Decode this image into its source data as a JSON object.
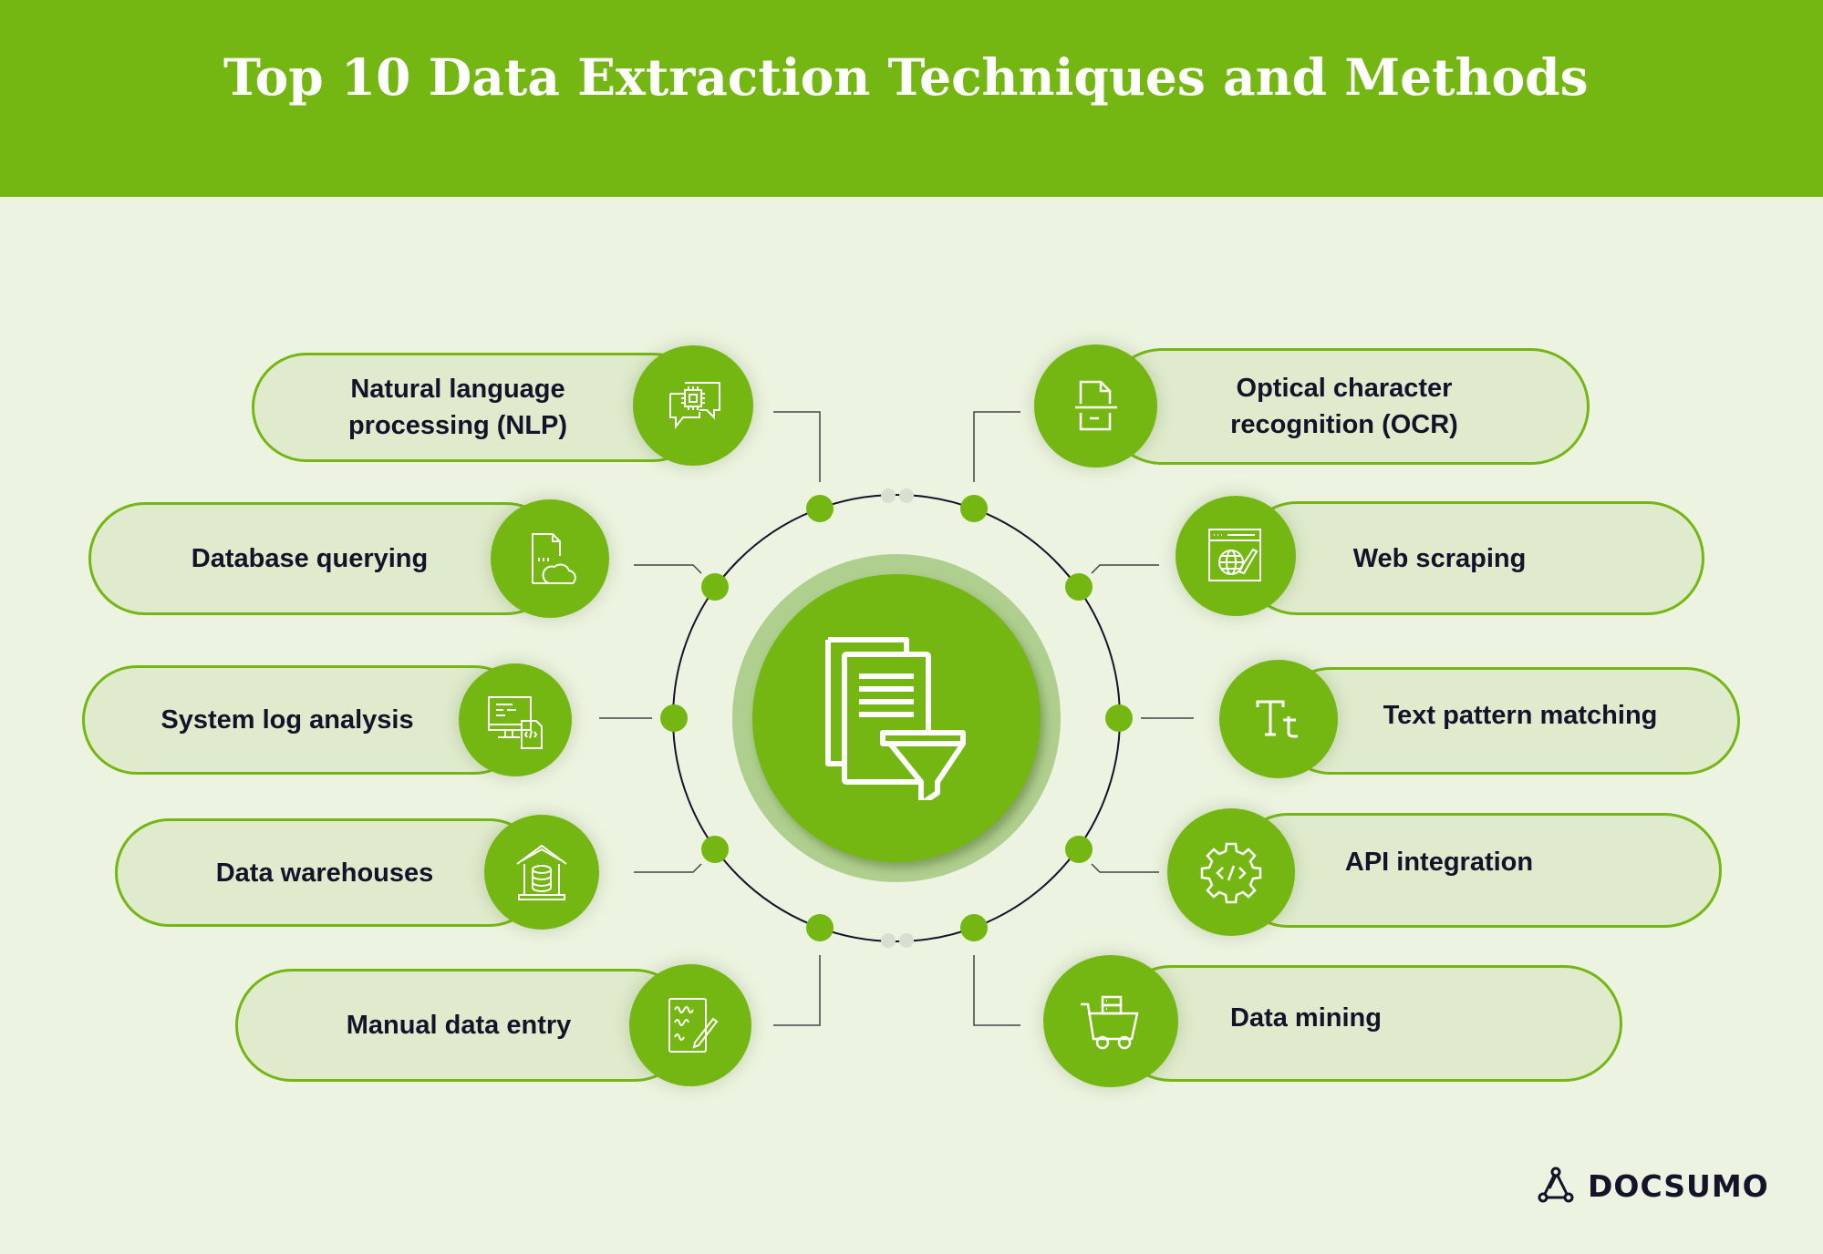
{
  "header": {
    "title": "Top 10 Data Extraction Techniques and Methods"
  },
  "center": {
    "icon": "documents-funnel-icon"
  },
  "techniques": {
    "left": [
      {
        "label_lines": [
          "Natural language",
          "processing (NLP)"
        ],
        "icon": "chat-chip-icon"
      },
      {
        "label_lines": [
          "Database querying"
        ],
        "icon": "database-cloud-icon"
      },
      {
        "label_lines": [
          "System log analysis"
        ],
        "icon": "monitor-code-file-icon"
      },
      {
        "label_lines": [
          "Data warehouses"
        ],
        "icon": "warehouse-database-icon"
      },
      {
        "label_lines": [
          "Manual data entry"
        ],
        "icon": "handwritten-form-icon"
      }
    ],
    "right": [
      {
        "label_lines": [
          "Optical character",
          "recognition (OCR)"
        ],
        "icon": "document-scan-icon"
      },
      {
        "label_lines": [
          "Web scraping"
        ],
        "icon": "browser-globe-brush-icon"
      },
      {
        "label_lines": [
          "Text pattern matching"
        ],
        "icon": "text-type-icon"
      },
      {
        "label_lines": [
          "API integration"
        ],
        "icon": "gear-code-icon"
      },
      {
        "label_lines": [
          "Data mining"
        ],
        "icon": "cart-server-icon"
      }
    ]
  },
  "brand": {
    "name": "DOCSUMO",
    "icon": "docsumo-logo-icon"
  },
  "colors": {
    "primary_green": "#74b713",
    "background": "#ecf3e0",
    "pill_fill": "#dfebcc",
    "text_dark": "#15132a",
    "halo": "#afcf8f"
  }
}
